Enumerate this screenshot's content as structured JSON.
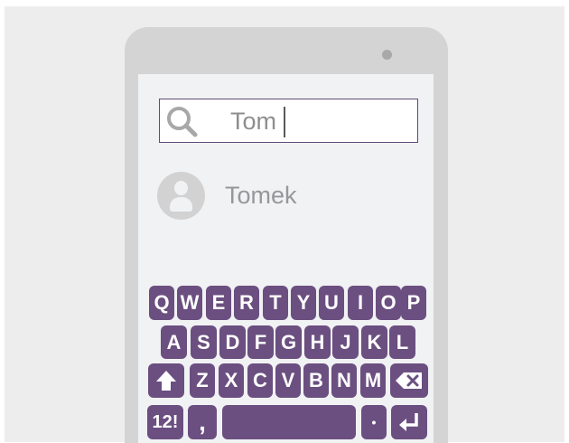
{
  "search": {
    "query": "Tom"
  },
  "results": [
    {
      "name": "Tomek"
    }
  ],
  "keyboard": {
    "row1": [
      "Q",
      "W",
      "E",
      "R",
      "T",
      "Y",
      "U",
      "I",
      "O",
      "P"
    ],
    "row2": [
      "A",
      "S",
      "D",
      "F",
      "G",
      "H",
      "J",
      "K",
      "L"
    ],
    "row3": [
      "Z",
      "X",
      "C",
      "V",
      "B",
      "N",
      "M"
    ],
    "numbers_label": "12!",
    "comma_label": ",",
    "period_label": "•"
  },
  "colors": {
    "key": "#6b4f80",
    "search_border": "#5f4a76",
    "screen": "#f1f2f4",
    "phone": "#d4d4d5"
  },
  "icons": [
    "search-icon",
    "avatar-icon",
    "shift-icon",
    "backspace-icon",
    "enter-icon"
  ]
}
